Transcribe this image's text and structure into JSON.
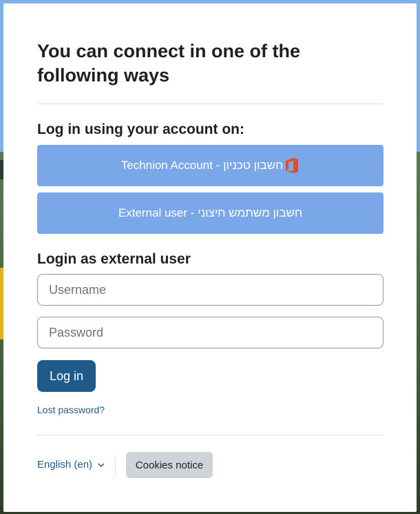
{
  "login": {
    "title": "You can connect in one of the following ways",
    "identity_providers_heading": "Log in using your account on:",
    "identity_providers": [
      {
        "label": "Technion Account - חשבון טכניון",
        "icon": "office-icon",
        "color": "#79a7e8"
      },
      {
        "label": "External user - חשבון משתמש חיצוני",
        "icon": "",
        "color": "#79a7e8"
      }
    ],
    "external_heading": "Login as external user",
    "username_placeholder": "Username",
    "password_placeholder": "Password",
    "login_button": "Log in",
    "lost_password": "Lost password?",
    "language": "English (en)",
    "cookies_notice": "Cookies notice"
  },
  "colors": {
    "primary": "#1e5a8a",
    "sso_button": "#79a7e8",
    "office_icon": "#e84c1a"
  }
}
